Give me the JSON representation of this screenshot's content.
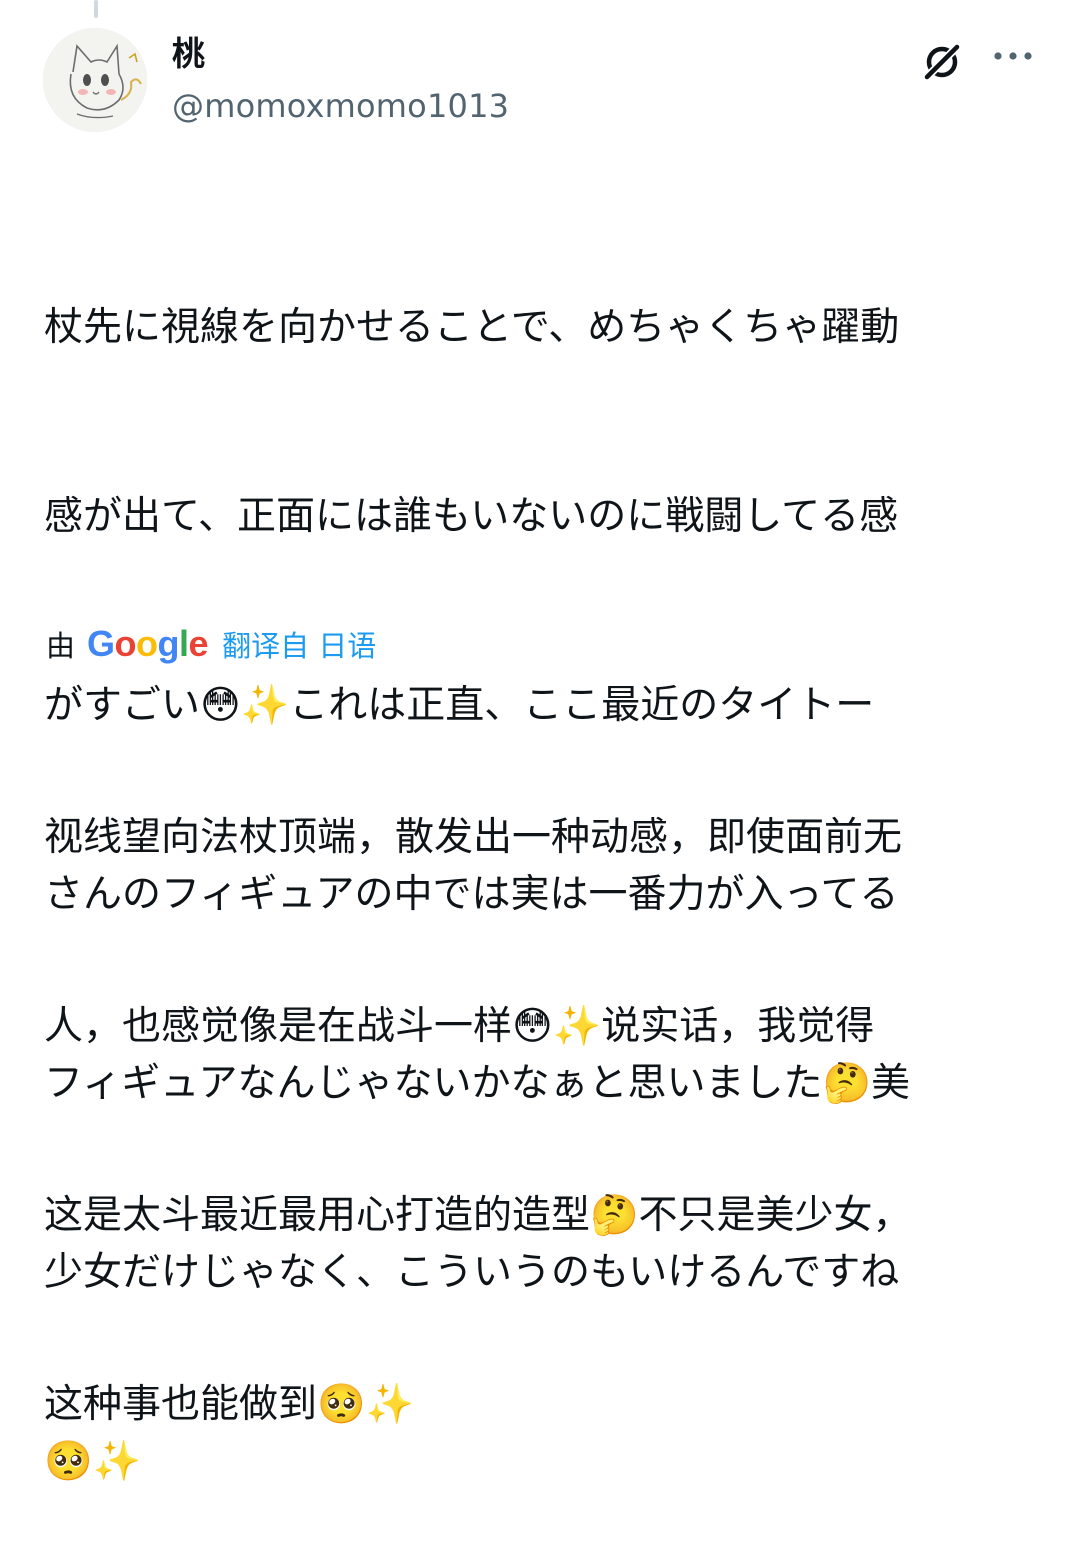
{
  "user": {
    "display_name": "桃",
    "handle": "@momoxmomo1013",
    "avatar_icon": "cat-sketch-avatar"
  },
  "post": {
    "lines": [
      "杖先に視線を向かせることで、めちゃくちゃ躍動",
      "感が出て、正面には誰もいないのに戦闘してる感",
      "がすごい😳✨これは正直、ここ最近のタイトー",
      "さんのフィギュアの中では実は一番力が入ってる",
      "フィギュアなんじゃないかなぁと思いました🤔美",
      "少女だけじゃなく、こういうのもいけるんですね",
      "🥺✨"
    ]
  },
  "translation": {
    "by_label": "由",
    "provider": "Google",
    "from_label": "翻译自 日语",
    "lines": [
      "视线望向法杖顶端，散发出一种动感，即使面前无",
      "人，也感觉像是在战斗一样😳✨说实话，我觉得",
      "这是太斗最近最用心打造的造型🤔不只是美少女，",
      "这种事也能做到🥺✨"
    ]
  },
  "icons": {
    "grok": "grok-icon",
    "more": "more-icon"
  },
  "colors": {
    "text": "#0f1419",
    "secondary": "#536471",
    "link": "#1d9bf0",
    "thread_line": "#cfd9de"
  }
}
